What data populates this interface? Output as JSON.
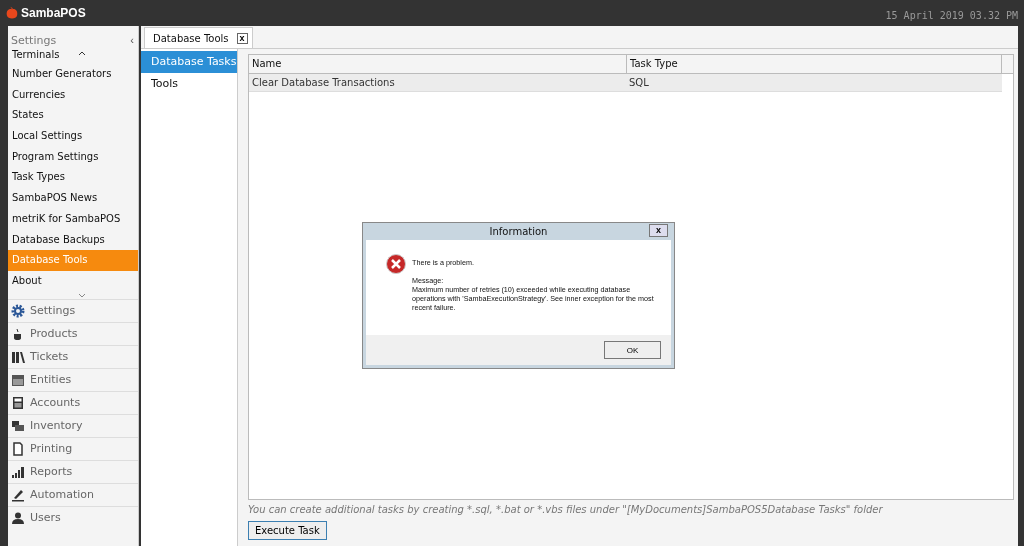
{
  "app": {
    "title": "SambaPOS",
    "datetime": "15 April 2019 03.32 PM"
  },
  "sidebar": {
    "title": "Settings",
    "collapse": "‹",
    "items": [
      {
        "label": "Terminals",
        "selected": false
      },
      {
        "label": "Number Generators",
        "selected": false
      },
      {
        "label": "Currencies",
        "selected": false
      },
      {
        "label": "States",
        "selected": false
      },
      {
        "label": "Local Settings",
        "selected": false
      },
      {
        "label": "Program Settings",
        "selected": false
      },
      {
        "label": "Task Types",
        "selected": false
      },
      {
        "label": "SambaPOS News",
        "selected": false
      },
      {
        "label": "metriK for SambaPOS",
        "selected": false
      },
      {
        "label": "Database Backups",
        "selected": false
      },
      {
        "label": "Database Tools",
        "selected": true
      },
      {
        "label": "About",
        "selected": false
      }
    ],
    "nav": [
      "Settings",
      "Products",
      "Tickets",
      "Entities",
      "Accounts",
      "Inventory",
      "Printing",
      "Reports",
      "Automation",
      "Users"
    ]
  },
  "tabs": [
    {
      "label": "Database Tools",
      "selected": true,
      "close": "x"
    }
  ],
  "subnav": [
    {
      "label": "Database Tasks",
      "selected": true
    },
    {
      "label": "Tools",
      "selected": false
    }
  ],
  "table": {
    "columns": [
      "Name",
      "Task Type"
    ],
    "rows": [
      {
        "cells": [
          "Clear Database Transactions",
          "SQL"
        ],
        "selected": true
      }
    ]
  },
  "hint": "You can create additional tasks by creating *.sql, *.bat or *.vbs files under \"[MyDocuments]SambaPOS5Database Tasks\" folder",
  "execute_button": "Execute Task",
  "dialog": {
    "title": "Information",
    "close": "x",
    "heading": "There is a problem.",
    "label": "Message:",
    "message": "Maximum number of retries (10) exceeded while executing database operations with 'SambaExecutionStrategy'. See inner exception for the most recent failure.",
    "ok": "OK"
  }
}
